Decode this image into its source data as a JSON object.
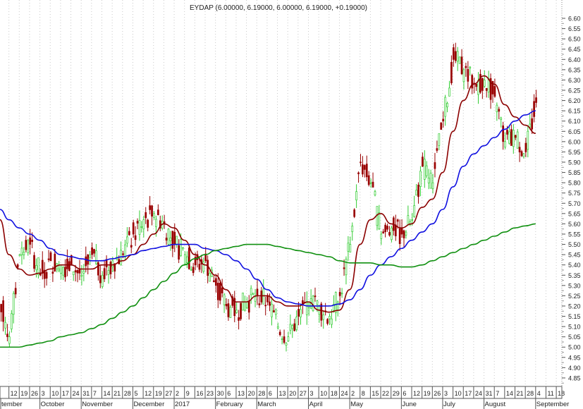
{
  "chart_data": {
    "type": "candlestick",
    "title": "EYDAP (6.00000, 6.19000, 6.00000, 6.19000, +0.19000)",
    "ylim": [
      4.82,
      6.68
    ],
    "y_ticks": [
      "6.60",
      "6.55",
      "6.50",
      "6.45",
      "6.40",
      "6.35",
      "6.30",
      "6.25",
      "6.20",
      "6.15",
      "6.10",
      "6.05",
      "6.00",
      "5.95",
      "5.90",
      "5.85",
      "5.80",
      "5.75",
      "5.70",
      "5.65",
      "5.60",
      "5.55",
      "5.50",
      "5.45",
      "5.40",
      "5.35",
      "5.30",
      "5.25",
      "5.20",
      "5.15",
      "5.10",
      "5.05",
      "5.00",
      "4.95",
      "4.90",
      "4.85"
    ],
    "grid": "vertical dotted",
    "week_labels": [
      "12",
      "19",
      "26",
      "3",
      "10",
      "17",
      "24",
      "31",
      "7",
      "14",
      "21",
      "28",
      "5",
      "12",
      "19",
      "27",
      "2",
      "9",
      "16",
      "23",
      "30",
      "6",
      "13",
      "20",
      "28",
      "6",
      "13",
      "20",
      "27",
      "3",
      "10",
      "18",
      "24",
      "2",
      "8",
      "15",
      "22",
      "29",
      "6",
      "12",
      "19",
      "26",
      "3",
      "10",
      "17",
      "24",
      "31",
      "7",
      "14",
      "21",
      "28",
      "4",
      "11",
      "18"
    ],
    "month_labels": [
      {
        "label": "tember",
        "week": 0
      },
      {
        "label": "October",
        "week": 4
      },
      {
        "label": "November",
        "week": 8
      },
      {
        "label": "December",
        "week": 13
      },
      {
        "label": "2017",
        "week": 17
      },
      {
        "label": "February",
        "week": 21
      },
      {
        "label": "March",
        "week": 25
      },
      {
        "label": "April",
        "week": 30
      },
      {
        "label": "May",
        "week": 34
      },
      {
        "label": "June",
        "week": 39
      },
      {
        "label": "July",
        "week": 43
      },
      {
        "label": "August",
        "week": 47
      },
      {
        "label": "September",
        "week": 52
      }
    ],
    "weekly_close": [
      5.25,
      5.05,
      5.45,
      5.5,
      5.35,
      5.42,
      5.4,
      5.4,
      5.35,
      5.45,
      5.35,
      5.42,
      5.45,
      5.55,
      5.62,
      5.65,
      5.6,
      5.5,
      5.45,
      5.4,
      5.42,
      5.3,
      5.2,
      5.18,
      5.22,
      5.25,
      5.22,
      5.1,
      5.05,
      5.15,
      5.22,
      5.2,
      5.15,
      5.25,
      5.5,
      5.9,
      5.8,
      5.55,
      5.58,
      5.55,
      5.62,
      5.88,
      5.8,
      6.1,
      6.4,
      6.35,
      6.28,
      6.3,
      6.22,
      6.0,
      6.02,
      5.95,
      6.19
    ],
    "series": [
      {
        "name": "MA short",
        "color": "#8b0000",
        "values": [
          5.62,
          5.45,
          5.38,
          5.35,
          5.36,
          5.38,
          5.4,
          5.4,
          5.38,
          5.38,
          5.4,
          5.4,
          5.42,
          5.45,
          5.5,
          5.55,
          5.6,
          5.58,
          5.52,
          5.45,
          5.4,
          5.35,
          5.28,
          5.22,
          5.22,
          5.25,
          5.25,
          5.22,
          5.2,
          5.2,
          5.22,
          5.18,
          5.17,
          5.18,
          5.28,
          5.5,
          5.62,
          5.65,
          5.6,
          5.58,
          5.6,
          5.68,
          5.72,
          5.85,
          6.05,
          6.2,
          6.28,
          6.32,
          6.28,
          6.18,
          6.12,
          6.08,
          6.04
        ]
      },
      {
        "name": "MA medium",
        "color": "#1010e0",
        "values": [
          5.67,
          5.62,
          5.58,
          5.55,
          5.52,
          5.48,
          5.45,
          5.44,
          5.43,
          5.42,
          5.42,
          5.43,
          5.44,
          5.45,
          5.47,
          5.48,
          5.49,
          5.5,
          5.5,
          5.5,
          5.48,
          5.47,
          5.45,
          5.42,
          5.38,
          5.33,
          5.28,
          5.24,
          5.22,
          5.21,
          5.2,
          5.2,
          5.2,
          5.21,
          5.23,
          5.28,
          5.35,
          5.4,
          5.44,
          5.48,
          5.52,
          5.56,
          5.6,
          5.67,
          5.78,
          5.88,
          5.94,
          5.98,
          6.02,
          6.06,
          6.1,
          6.13,
          6.15
        ]
      },
      {
        "name": "MA long",
        "color": "#109010",
        "values": [
          5.0,
          5.0,
          5.0,
          5.01,
          5.02,
          5.03,
          5.05,
          5.06,
          5.07,
          5.09,
          5.11,
          5.14,
          5.17,
          5.2,
          5.24,
          5.28,
          5.32,
          5.36,
          5.4,
          5.43,
          5.45,
          5.47,
          5.48,
          5.49,
          5.5,
          5.5,
          5.5,
          5.49,
          5.48,
          5.47,
          5.46,
          5.45,
          5.44,
          5.42,
          5.41,
          5.41,
          5.41,
          5.4,
          5.4,
          5.39,
          5.39,
          5.4,
          5.42,
          5.44,
          5.46,
          5.48,
          5.5,
          5.52,
          5.54,
          5.56,
          5.58,
          5.59,
          5.6
        ]
      }
    ],
    "up_color": "#33cc33",
    "down_color": "#990000"
  }
}
